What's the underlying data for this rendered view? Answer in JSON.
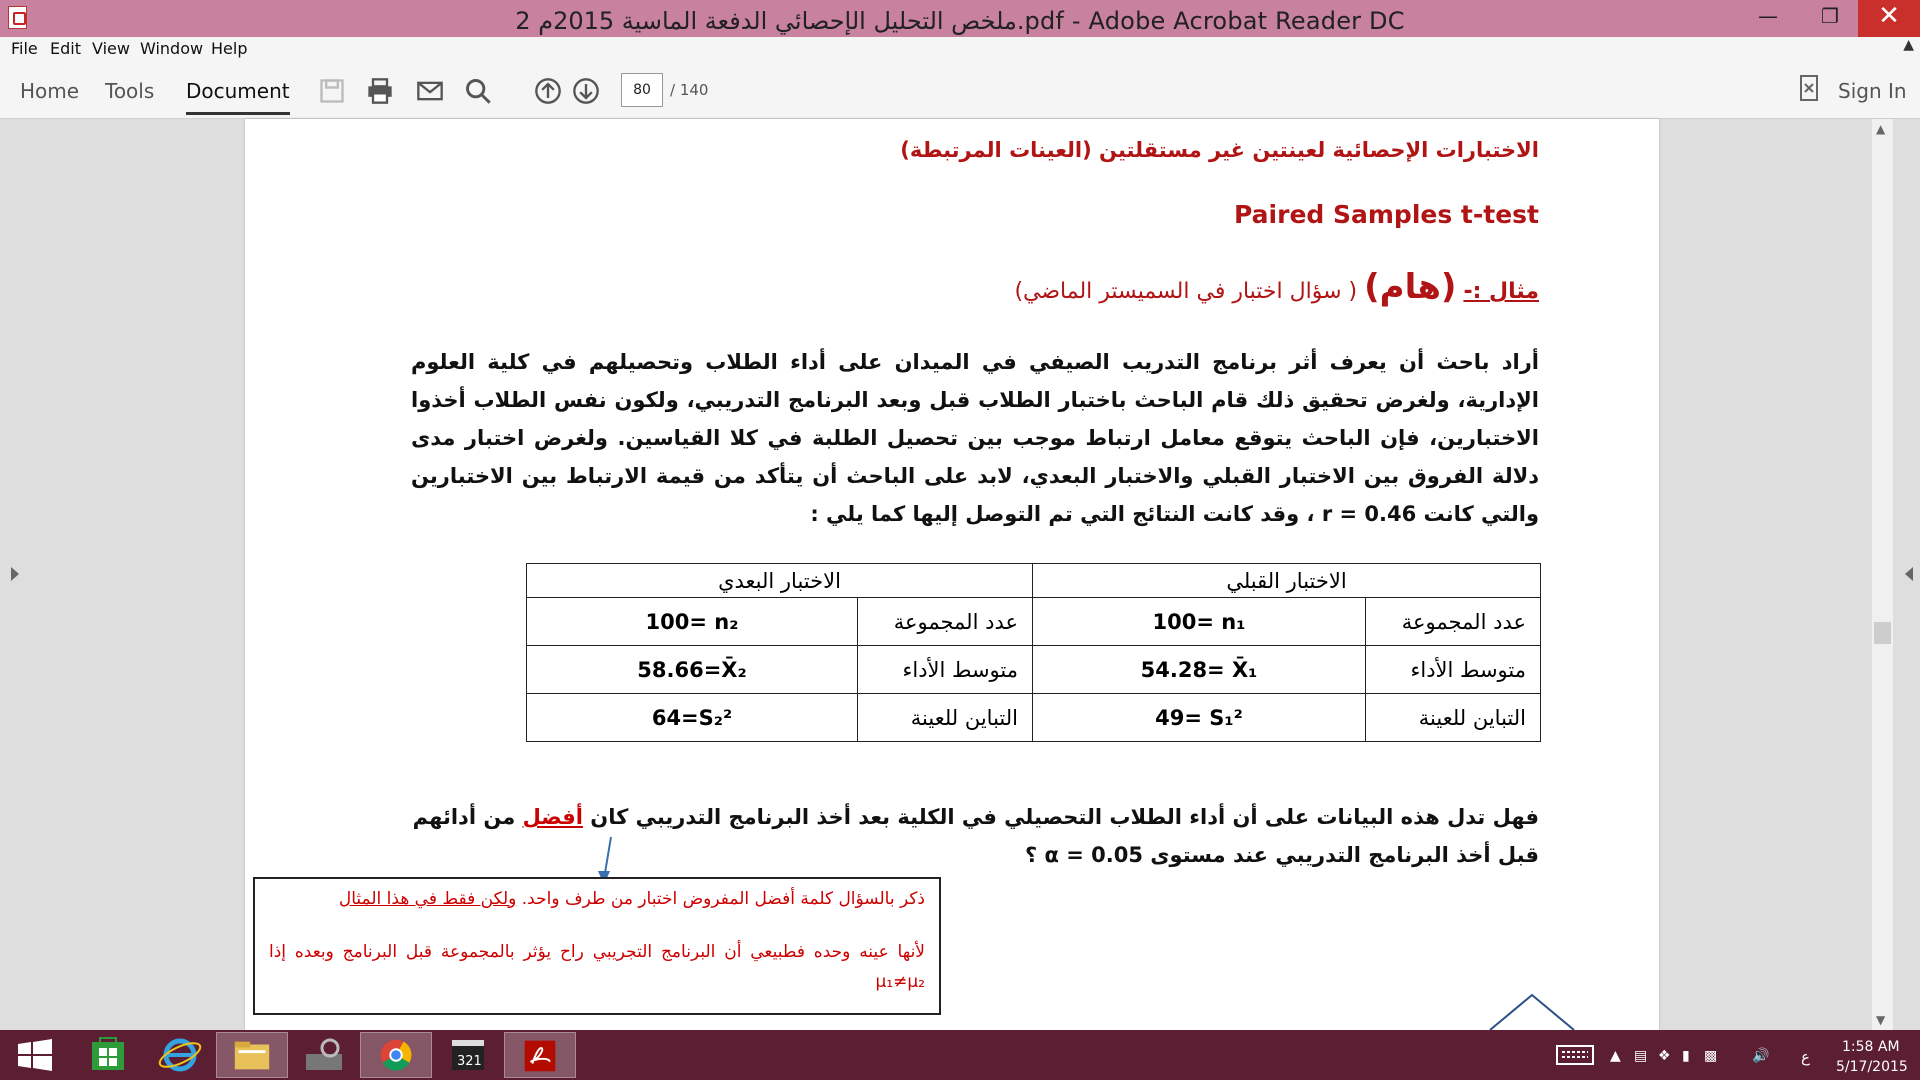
{
  "window": {
    "title": "ملخص التحليل الإحصائي الدفعة الماسية 2015م 2.pdf - Adobe Acrobat Reader DC"
  },
  "menu": [
    "File",
    "Edit",
    "View",
    "Window",
    "Help"
  ],
  "tabs": {
    "home": "Home",
    "tools": "Tools",
    "document": "Document"
  },
  "pager": {
    "current": "80",
    "total": "/ 140"
  },
  "signin": "Sign In",
  "doc": {
    "heading1": "الاختبارات الإحصائية لعينتين غير مستقلتين (العينات المرتبطة)",
    "heading2": "Paired Samples t-test",
    "example_label": "مثال :-",
    "example_important": "(هام)",
    "example_note": "( سؤال اختبار في السميستر الماضي)",
    "paragraph": "أراد باحث أن يعرف أثر برنامج التدريب الصيفي في الميدان على أداء الطلاب وتحصيلهم في كلية العلوم الإدارية، ولغرض تحقيق ذلك قام الباحث باختبار الطلاب قبل وبعد البرنامج التدريبي، ولكون نفس الطلاب أخذوا الاختبارين، فإن الباحث يتوقع معامل ارتباط موجب بين تحصيل الطلبة في كلا القياسين.  ولغرض اختبار مدى دلالة الفروق بين الاختبار القبلي والاختبار البعدي، لابد على الباحث أن يتأكد من قيمة الارتباط بين الاختبارين والتي كانت r = 0.46 ، وقد كانت النتائج التي تم التوصل إليها كما يلي :",
    "table": {
      "pre_header": "الاختبار القبلي",
      "post_header": "الاختبار البعدي",
      "rows": [
        {
          "label": "عدد المجموعة",
          "pre": "100= n₁",
          "post": "100= n₂"
        },
        {
          "label": "متوسط الأداء",
          "pre": "54.28= X̄₁",
          "post": "58.66=X̄₂"
        },
        {
          "label": "التباين للعينة",
          "pre": "49=  S₁²",
          "post": "64=S₂²"
        }
      ]
    },
    "question_a": "فهل تدل هذه البيانات على أن أداء الطلاب التحصيلي في الكلية بعد أخذ البرنامج التدريبي كان",
    "question_best": "أفضل",
    "question_b": "من أدائهم قبل أخذ البرنامج التدريبي عند مستوى α = 0.05 ؟",
    "note_line1": "ذكر بالسؤال كلمة أفضل المفروض اختبار من طرف واحد.",
    "note_line1_u": "ولكن فقط في هذا المثال",
    "note_line2": "لأنها عينه وحده فطبيعي أن البرنامج التجريبي راح يؤثر بالمجموعة قبل البرنامج وبعده إذا μ₁≠μ₂"
  },
  "taskbar": {
    "time": "1:58 AM",
    "date": "5/17/2015",
    "lang": "ع"
  },
  "colors": {
    "titlebar": "#c8819e",
    "taskbar": "#5b1e33",
    "heading_red": "#b11414",
    "close": "#c9302c"
  }
}
